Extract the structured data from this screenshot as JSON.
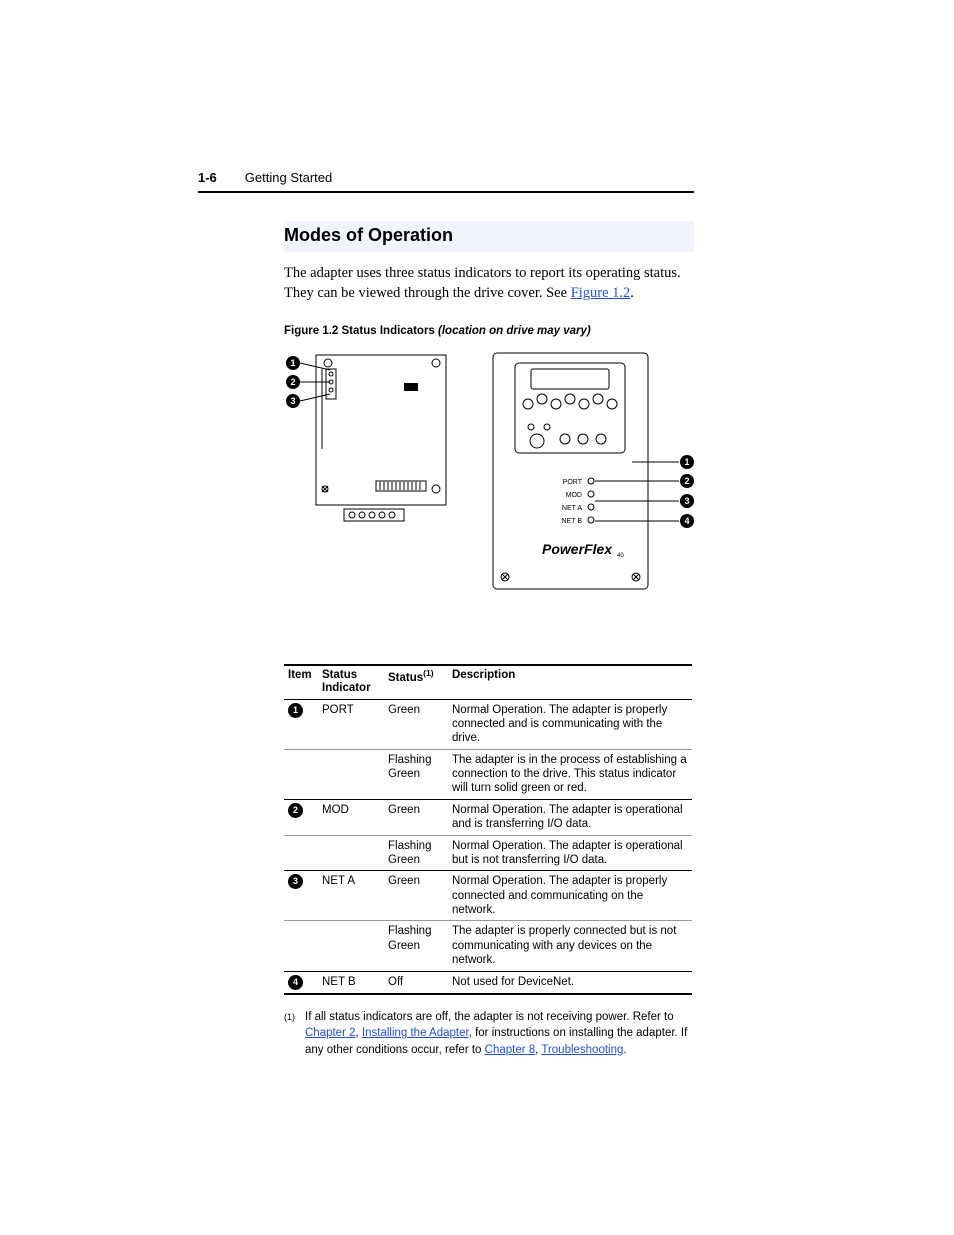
{
  "header": {
    "page_number": "1-6",
    "chapter_title": "Getting Started"
  },
  "section": {
    "title": "Modes of Operation"
  },
  "intro": {
    "sentence1": "The adapter uses three status indicators to report its operating status. They can be viewed through the drive cover. See ",
    "figure_link": "Figure 1.2",
    "sentence1_end": "."
  },
  "figure_caption": {
    "prefix": "Figure 1.2   Status Indicators ",
    "italic": "(location on drive may vary)"
  },
  "figure_labels": {
    "left_callouts": [
      "1",
      "2",
      "3"
    ],
    "right_callouts": [
      "1",
      "2",
      "3",
      "4"
    ],
    "right_port_labels": [
      "PORT",
      "MOD",
      "NET A",
      "NET B"
    ],
    "brand_text": "PowerFlex"
  },
  "table": {
    "headers": {
      "item": "Item",
      "indicator": "Status Indicator",
      "status": "Status",
      "status_sup": "(1)",
      "description": "Description"
    },
    "rows": [
      {
        "item_num": "1",
        "indicator": "PORT",
        "subrows": [
          {
            "status": "Green",
            "desc": "Normal Operation. The adapter is properly connected and is communicating with the drive."
          },
          {
            "status": "Flashing Green",
            "desc": "The adapter is in the process of establishing a connection to the drive. This status indicator will turn solid green or red."
          }
        ]
      },
      {
        "item_num": "2",
        "indicator": "MOD",
        "subrows": [
          {
            "status": "Green",
            "desc": "Normal Operation. The adapter is operational and is transferring I/O data."
          },
          {
            "status": "Flashing Green",
            "desc": "Normal Operation. The adapter is operational but is not transferring I/O data."
          }
        ]
      },
      {
        "item_num": "3",
        "indicator": "NET A",
        "subrows": [
          {
            "status": "Green",
            "desc": "Normal Operation. The adapter is properly connected and communicating on the network."
          },
          {
            "status": "Flashing Green",
            "desc": "The adapter is properly connected but is not communicating with any devices on the network."
          }
        ]
      },
      {
        "item_num": "4",
        "indicator": "NET B",
        "subrows": [
          {
            "status": "Off",
            "desc": "Not used for DeviceNet."
          }
        ]
      }
    ]
  },
  "footnote": {
    "marker": "(1)",
    "text_a": "If all status indicators are off, the adapter is not receiving power. Refer to ",
    "link1": "Chapter 2",
    "text_b": ", ",
    "link2": "Installing the Adapter",
    "text_c": ", for instructions on installing the adapter. If any other conditions occur, refer to ",
    "link3": "Chapter 8",
    "text_d": ", ",
    "link4": "Troubleshooting",
    "text_e": "."
  }
}
